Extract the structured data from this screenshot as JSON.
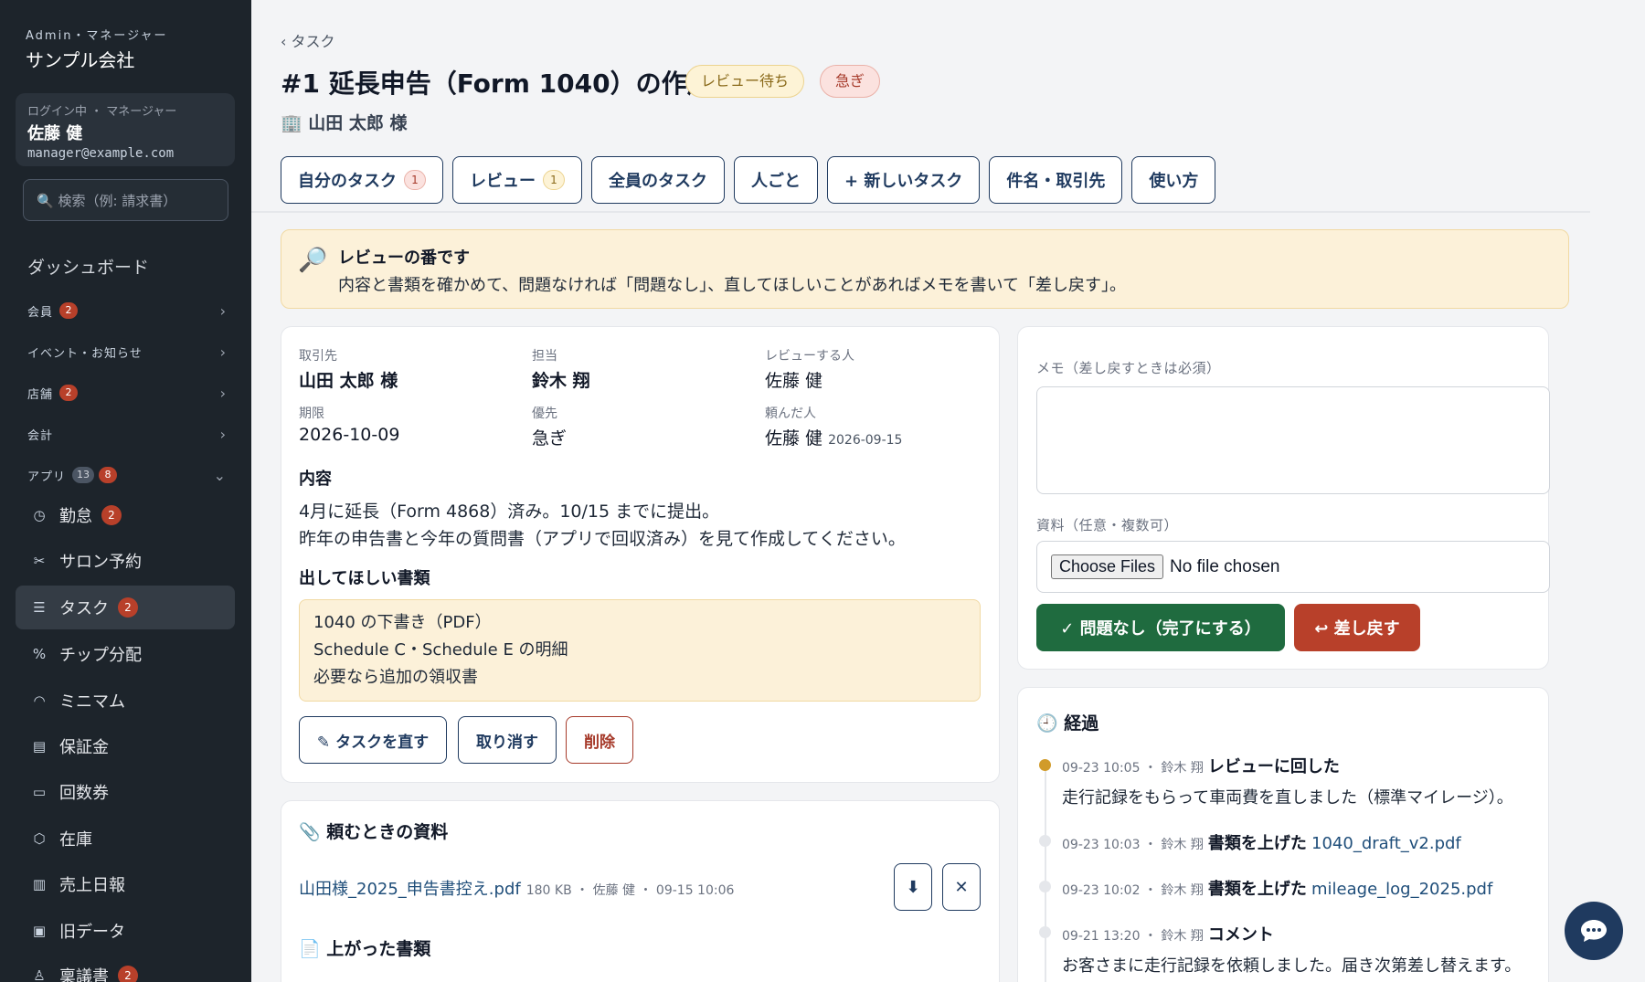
{
  "sidebar": {
    "org_role": "Admin・マネージャー",
    "org_name": "サンプル会社",
    "user": {
      "label": "ログイン中 ・ マネージャー",
      "name": "佐藤 健",
      "email": "manager@example.com"
    },
    "search_placeholder": "🔍 検索（例: 請求書）",
    "dashboard": "ダッシュボード",
    "sections": [
      {
        "label": "会員",
        "badge": "2"
      },
      {
        "label": "イベント・お知らせ"
      },
      {
        "label": "店舗",
        "badge": "2"
      },
      {
        "label": "会計"
      },
      {
        "label": "アプリ",
        "count": "13",
        "badge": "8"
      }
    ],
    "items": [
      {
        "label": "勤怠",
        "badge": "2"
      },
      {
        "label": "サロン予約"
      },
      {
        "label": "タスク",
        "badge": "2"
      },
      {
        "label": "チップ分配"
      },
      {
        "label": "ミニマム"
      },
      {
        "label": "保証金"
      },
      {
        "label": "回数券"
      },
      {
        "label": "在庫"
      },
      {
        "label": "売上日報"
      },
      {
        "label": "旧データ"
      },
      {
        "label": "稟議書",
        "badge": "2"
      }
    ]
  },
  "header": {
    "breadcrumb": "‹ タスク",
    "title": "#1 延長申告（Form 1040）の作成",
    "status_badge": "レビュー待ち",
    "priority_badge": "急ぎ",
    "client": "🏢 山田 太郎 様"
  },
  "tabs": [
    {
      "label": "自分のタスク",
      "count": "1"
    },
    {
      "label": "レビュー",
      "count": "1"
    },
    {
      "label": "全員のタスク"
    },
    {
      "label": "人ごと"
    },
    {
      "label": "+ 新しいタスク"
    },
    {
      "label": "件名・取引先"
    },
    {
      "label": "使い方"
    }
  ],
  "alert": {
    "title": "レビューの番です",
    "body": "内容と書類を確かめて、問題なければ「問題なし」、直してほしいことがあればメモを書いて「差し戻す」。"
  },
  "details": {
    "client": {
      "key": "取引先",
      "value": "山田 太郎 様"
    },
    "assignee": {
      "key": "担当",
      "value": "鈴木 翔"
    },
    "reviewer": {
      "key": "レビューする人",
      "value": "佐藤 健"
    },
    "due": {
      "key": "期限",
      "value": "2026-10-09"
    },
    "priority": {
      "key": "優先",
      "value": "急ぎ"
    },
    "requester": {
      "key": "頼んだ人",
      "value": "佐藤 健",
      "date": "2026-09-15"
    },
    "content_heading": "内容",
    "content_lines": [
      "4月に延長（Form 4868）済み。10/15 までに提出。",
      "昨年の申告書と今年の質問書（アプリで回収済み）を見て作成してください。"
    ],
    "docs_heading": "出してほしい書類",
    "docs": [
      "1040 の下書き（PDF）",
      "Schedule C・Schedule E の明細",
      "必要なら追加の領収書"
    ],
    "edit_button": "✎ タスクを直す",
    "cancel_button": "取り消す",
    "delete_button": "削除"
  },
  "files": {
    "heading": "📎 頼むときの資料",
    "file_name": "山田様_2025_申告書控え.pdf",
    "file_meta": "180 KB ・ 佐藤 健 ・ 09-15 10:06",
    "download_icon": "⬇",
    "remove_icon": "✕",
    "uploaded_heading": "📄 上がった書類"
  },
  "review_form": {
    "memo_label": "メモ（差し戻すときは必須）",
    "files_label": "資料（任意・複数可）",
    "choose_files": "Choose Files",
    "no_file": "No file chosen",
    "approve_button": "✓ 問題なし（完了にする）",
    "return_button": "↩ 差し戻す"
  },
  "history": {
    "heading": "🕘 経過",
    "events": [
      {
        "meta": "09-23 10:05 ・ 鈴木 翔",
        "action": "レビューに回した",
        "text": "走行記録をもらって車両費を直しました（標準マイレージ）。"
      },
      {
        "meta": "09-23 10:03 ・ 鈴木 翔",
        "action": "書類を上げた",
        "file": "1040_draft_v2.pdf"
      },
      {
        "meta": "09-23 10:02 ・ 鈴木 翔",
        "action": "書類を上げた",
        "file": "mileage_log_2025.pdf"
      },
      {
        "meta": "09-21 13:20 ・ 鈴木 翔",
        "action": "コメント",
        "text": "お客さまに走行記録を依頼しました。届き次第差し替えます。"
      }
    ]
  },
  "colors": {
    "sidebar_bg": "#1d242b",
    "primary": "#1f3a5f",
    "success": "#1f6b3f",
    "danger": "#b8402a",
    "warning_bg": "#fcf1d9"
  }
}
